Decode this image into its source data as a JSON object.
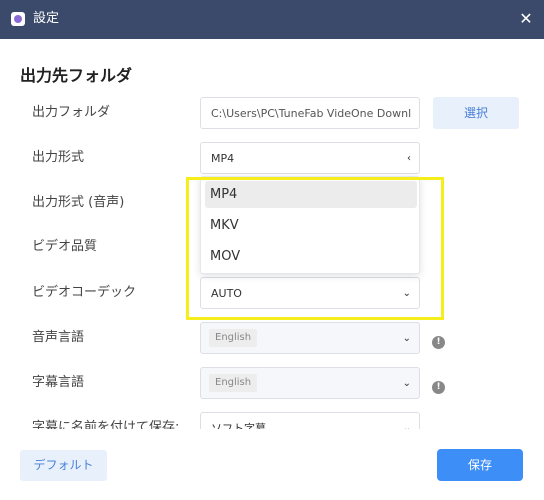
{
  "window": {
    "title": "設定",
    "close_glyph": "✕"
  },
  "section": {
    "title": "出力先フォルダ"
  },
  "rows": {
    "output_folder": {
      "label": "出力フォルダ",
      "value": "C:\\Users\\PC\\TuneFab VideOne Downl",
      "button": "選択"
    },
    "output_format": {
      "label": "出力形式",
      "value": "MP4",
      "chevron": "‹"
    },
    "audio_format": {
      "label": "出力形式 (音声)"
    },
    "video_quality": {
      "label": "ビデオ品質"
    },
    "video_codec": {
      "label": "ビデオコーデック",
      "value": "AUTO",
      "chevron": "⌄"
    },
    "audio_language": {
      "label": "音声言語",
      "value": "English",
      "chevron": "⌄",
      "info": "!"
    },
    "subtitle_language": {
      "label": "字幕言語",
      "value": "English",
      "chevron": "⌄",
      "info": "!"
    },
    "save_subtitle": {
      "label": "字幕に名前を付けて保存:",
      "value": "ソフト字幕",
      "chevron": "⌄"
    }
  },
  "dropdown": {
    "options": [
      {
        "label": "MP4",
        "selected": true
      },
      {
        "label": "MKV",
        "selected": false
      },
      {
        "label": "MOV",
        "selected": false
      }
    ]
  },
  "footer": {
    "default_label": "デフォルト",
    "save_label": "保存"
  },
  "colors": {
    "titlebar": "#3b4a6b",
    "accent": "#3e8ef7",
    "highlight": "#f5ee1b"
  },
  "icons": {
    "app": "app-logo-icon",
    "close": "close-icon",
    "warning": "info-exclamation-icon"
  }
}
